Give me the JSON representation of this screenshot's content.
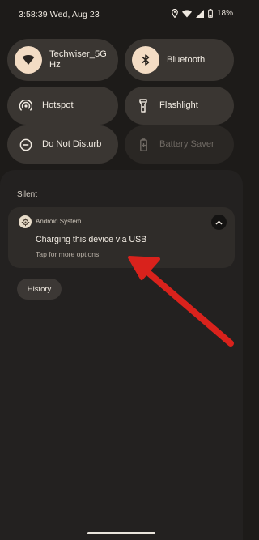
{
  "status_bar": {
    "time_date": "3:58:39 Wed, Aug 23",
    "battery": "18%",
    "icons": [
      "location-icon",
      "wifi-icon",
      "cell-signal-icon",
      "battery-icon"
    ]
  },
  "quick_settings": {
    "tiles": [
      {
        "label": "Techwiser_5G Hz",
        "icon": "wifi-icon",
        "active": true
      },
      {
        "label": "Bluetooth",
        "icon": "bluetooth-icon",
        "active": true
      },
      {
        "label": "Hotspot",
        "icon": "hotspot-icon",
        "active": false
      },
      {
        "label": "Flashlight",
        "icon": "flashlight-icon",
        "active": false
      },
      {
        "label": "Do Not Disturb",
        "icon": "do-not-disturb-icon",
        "active": false
      },
      {
        "label": "Battery Saver",
        "icon": "battery-saver-icon",
        "active": false,
        "disabled": true
      }
    ]
  },
  "notifications": {
    "section_title": "Silent",
    "items": [
      {
        "app_name": "Android System",
        "title": "Charging this device via USB",
        "subtitle": "Tap for more options."
      }
    ],
    "history_label": "History"
  },
  "colors": {
    "background": "#1d1b19",
    "shade": "#232120",
    "tile": "#3a3632",
    "active_bubble": "#f3dcc4",
    "annotation_arrow": "#d9221c"
  }
}
